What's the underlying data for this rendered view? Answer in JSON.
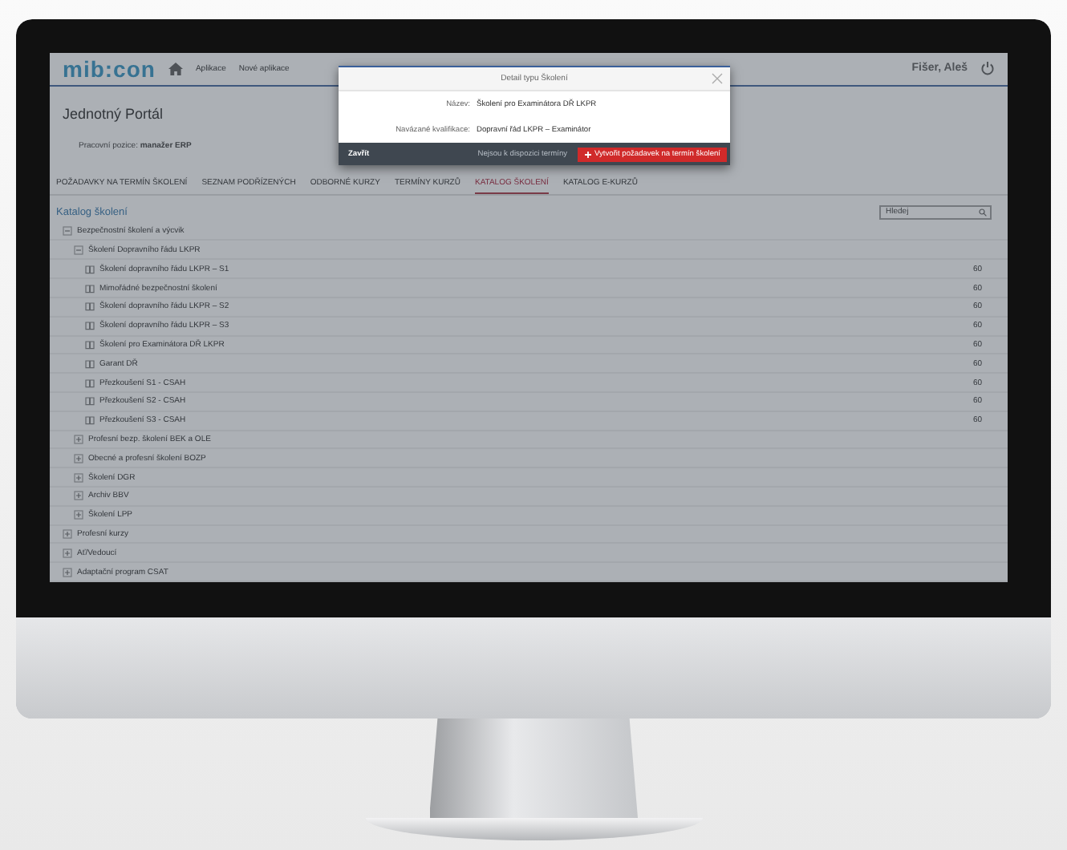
{
  "header": {
    "logo": "mib:con",
    "nav": [
      "Aplikace",
      "Nové aplikace"
    ],
    "user": "Fišer, Aleš"
  },
  "page": {
    "title": "Jednotný Portál",
    "position_label": "Pracovní pozice:",
    "position_value": "manažer ERP"
  },
  "tabs": [
    {
      "label": "POŽADAVKY NA TERMÍN ŠKOLENÍ",
      "selected": false
    },
    {
      "label": "SEZNAM PODŘÍZENÝCH",
      "selected": false
    },
    {
      "label": "ODBORNÉ KURZY",
      "selected": false
    },
    {
      "label": "TERMÍNY KURZŮ",
      "selected": false
    },
    {
      "label": "KATALOG ŠKOLENÍ",
      "selected": true
    },
    {
      "label": "KATALOG E-KURZŮ",
      "selected": false
    }
  ],
  "catalog": {
    "title": "Katalog školení",
    "search": {
      "placeholder": "Hledej"
    },
    "tree": [
      {
        "label": "Bezpečnostní školení a výcvik",
        "expanded": true,
        "children": [
          {
            "label": "Školení Dopravního řádu LKPR",
            "expanded": true,
            "children": [
              {
                "label": "Školení dopravního řádu LKPR – S1",
                "value": "60"
              },
              {
                "label": "Mimořádné bezpečnostní školení",
                "value": "60"
              },
              {
                "label": "Školení dopravního řádu LKPR – S2",
                "value": "60"
              },
              {
                "label": "Školení dopravního řádu LKPR – S3",
                "value": "60"
              },
              {
                "label": "Školení pro Examinátora DŘ LKPR",
                "value": "60"
              },
              {
                "label": "Garant DŘ",
                "value": "60"
              },
              {
                "label": "Přezkoušení S1 - CSAH",
                "value": "60"
              },
              {
                "label": "Přezkoušení S2 - CSAH",
                "value": "60"
              },
              {
                "label": "Přezkoušení S3 - CSAH",
                "value": "60"
              }
            ]
          },
          {
            "label": "Profesní bezp. školení BEK a OLE",
            "expanded": false
          },
          {
            "label": "Obecné a profesní školení BOZP",
            "expanded": false
          },
          {
            "label": "Školení DGR",
            "expanded": false
          },
          {
            "label": "Archiv BBV",
            "expanded": false
          },
          {
            "label": "Školení LPP",
            "expanded": false
          }
        ]
      },
      {
        "label": "Profesní kurzy",
        "expanded": false
      },
      {
        "label": "Ať/Vedoucí",
        "expanded": false
      },
      {
        "label": "Adaptační program CSAT",
        "expanded": false
      }
    ]
  },
  "modal": {
    "title": "Detail typu Školení",
    "fields": [
      {
        "label": "Název:",
        "value": "Školení pro Examinátora DŘ LKPR"
      },
      {
        "label": "Navázané kvalifikace:",
        "value": "Dopravní řád LKPR – Examinátor"
      }
    ],
    "close_button": "Zavřít",
    "note": "Nejsou k dispozici termíny",
    "action_button": "Vytvořit požadavek na termín školení"
  }
}
